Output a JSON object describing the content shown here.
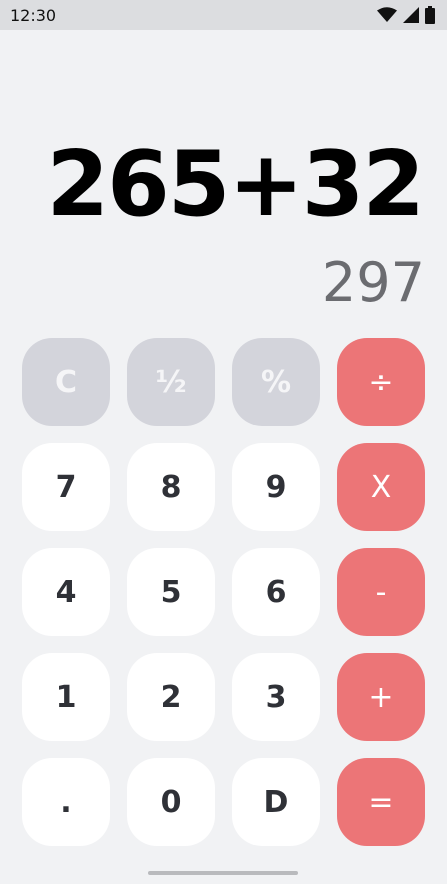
{
  "status_bar": {
    "time": "12:30",
    "icons": [
      "wifi-icon",
      "cell-signal-icon",
      "battery-icon"
    ]
  },
  "display": {
    "expression": "265+32",
    "result": "297"
  },
  "keypad": {
    "rows": [
      [
        {
          "label": "C",
          "kind": "func",
          "name": "clear-button"
        },
        {
          "label": "½",
          "kind": "func",
          "name": "half-button"
        },
        {
          "label": "%",
          "kind": "func",
          "name": "percent-button"
        },
        {
          "label": "÷",
          "kind": "op",
          "name": "divide-button"
        }
      ],
      [
        {
          "label": "7",
          "kind": "num",
          "name": "digit-7-button"
        },
        {
          "label": "8",
          "kind": "num",
          "name": "digit-8-button"
        },
        {
          "label": "9",
          "kind": "num",
          "name": "digit-9-button"
        },
        {
          "label": "X",
          "kind": "op",
          "name": "multiply-button"
        }
      ],
      [
        {
          "label": "4",
          "kind": "num",
          "name": "digit-4-button"
        },
        {
          "label": "5",
          "kind": "num",
          "name": "digit-5-button"
        },
        {
          "label": "6",
          "kind": "num",
          "name": "digit-6-button"
        },
        {
          "label": "-",
          "kind": "op",
          "name": "subtract-button"
        }
      ],
      [
        {
          "label": "1",
          "kind": "num",
          "name": "digit-1-button"
        },
        {
          "label": "2",
          "kind": "num",
          "name": "digit-2-button"
        },
        {
          "label": "3",
          "kind": "num",
          "name": "digit-3-button"
        },
        {
          "label": "+",
          "kind": "op",
          "name": "add-button"
        }
      ],
      [
        {
          "label": ".",
          "kind": "num",
          "name": "decimal-button"
        },
        {
          "label": "0",
          "kind": "num",
          "name": "digit-0-button"
        },
        {
          "label": "D",
          "kind": "num",
          "name": "delete-button"
        },
        {
          "label": "=",
          "kind": "op",
          "name": "equals-button"
        }
      ]
    ]
  },
  "colors": {
    "background": "#f1f2f4",
    "status_bar": "#dcdde0",
    "function_key": "#d3d4db",
    "number_key": "#ffffff",
    "operator_key": "#ec7577",
    "expression_text": "#000000",
    "result_text": "#6b6c70"
  }
}
